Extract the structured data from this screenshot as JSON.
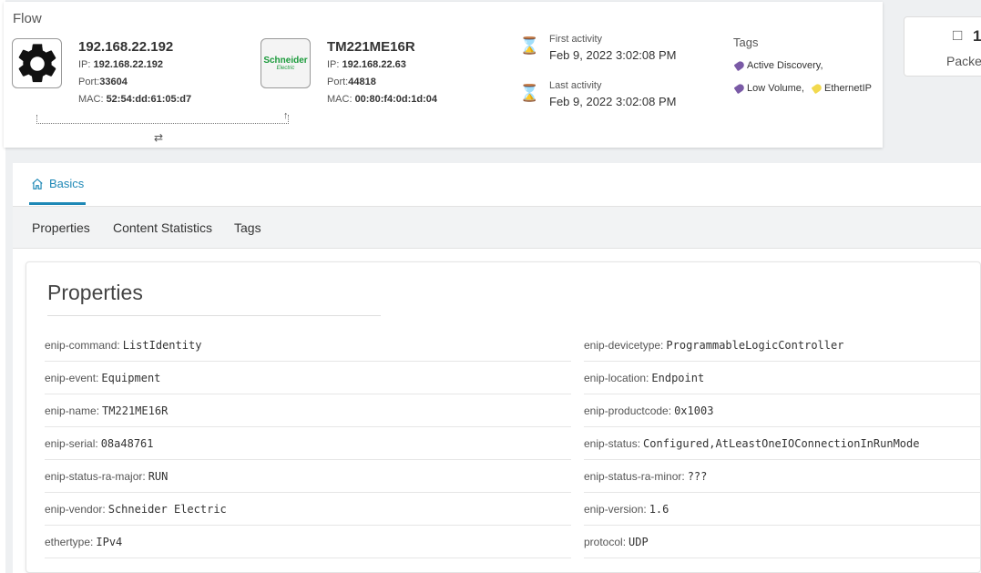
{
  "flow": {
    "title": "Flow",
    "source": {
      "title": "192.168.22.192",
      "ip_label": "IP:",
      "ip": "192.168.22.192",
      "port_label": "Port:",
      "port": "33604",
      "mac_label": "MAC:",
      "mac": "52:54:dd:61:05:d7",
      "icon": "gear-icon"
    },
    "destination": {
      "title": "TM221ME16R",
      "ip_label": "IP:",
      "ip": "192.168.22.63",
      "port_label": "Port:",
      "port": "44818",
      "mac_label": "MAC:",
      "mac": "00:80:f4:0d:1d:04",
      "logo_text": "Schneider",
      "logo_sub": "Electric"
    },
    "first_activity_label": "First activity",
    "first_activity_value": "Feb 9, 2022 3:02:08 PM",
    "last_activity_label": "Last activity",
    "last_activity_value": "Feb 9, 2022 3:02:08 PM",
    "tags_title": "Tags",
    "tags": [
      {
        "label": "Active Discovery,",
        "color": "#7a5aa6"
      },
      {
        "label": "Low Volume,",
        "color": "#7a5aa6"
      },
      {
        "label": "EthernetIP",
        "color": "#f2d94e"
      }
    ],
    "packets_count": "1",
    "packets_label": "Packe"
  },
  "tabs": {
    "basics": "Basics",
    "subtabs": [
      "Properties",
      "Content Statistics",
      "Tags"
    ]
  },
  "properties": {
    "title": "Properties",
    "left": [
      {
        "key": "enip-command:",
        "value": "ListIdentity"
      },
      {
        "key": "enip-event:",
        "value": "Equipment"
      },
      {
        "key": "enip-name:",
        "value": "TM221ME16R"
      },
      {
        "key": "enip-serial:",
        "value": "08a48761"
      },
      {
        "key": "enip-status-ra-major:",
        "value": "RUN"
      },
      {
        "key": "enip-vendor:",
        "value": "Schneider Electric"
      },
      {
        "key": "ethertype:",
        "value": "IPv4"
      }
    ],
    "right": [
      {
        "key": "enip-devicetype:",
        "value": "ProgrammableLogicController"
      },
      {
        "key": "enip-location:",
        "value": "Endpoint"
      },
      {
        "key": "enip-productcode:",
        "value": "0x1003"
      },
      {
        "key": "enip-status:",
        "value": "Configured,AtLeastOneIOConnectionInRunMode"
      },
      {
        "key": "enip-status-ra-minor:",
        "value": "???"
      },
      {
        "key": "enip-version:",
        "value": "1.6"
      },
      {
        "key": "protocol:",
        "value": "UDP"
      }
    ]
  }
}
